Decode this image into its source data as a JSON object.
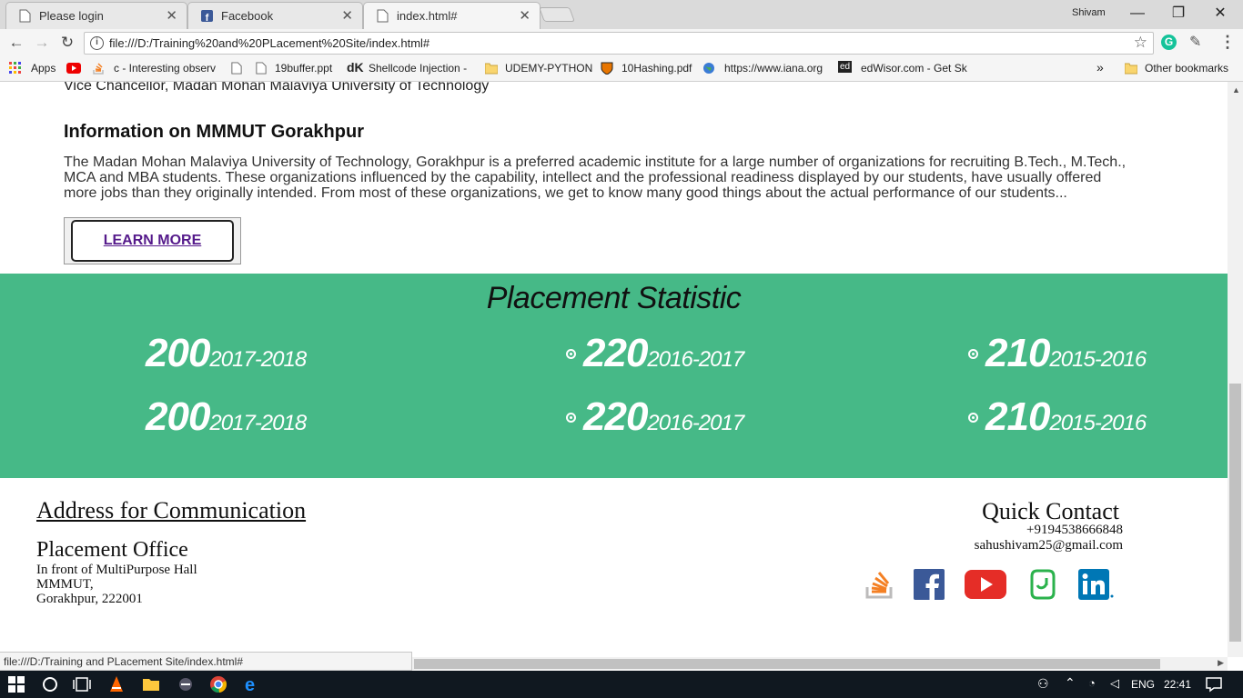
{
  "browser": {
    "tabs": [
      {
        "title": "Please login",
        "icon": "page-icon",
        "active": false
      },
      {
        "title": "Facebook",
        "icon": "facebook-favicon",
        "active": false
      },
      {
        "title": "index.html#",
        "icon": "page-icon",
        "active": true
      }
    ],
    "profile_name": "Shivam",
    "url": "file:///D:/Training%20and%20PLacement%20Site/index.html#",
    "bookmarks": [
      {
        "label": "Apps",
        "icon": "apps-icon"
      },
      {
        "label": "",
        "icon": "youtube-icon"
      },
      {
        "label": "c - Interesting observ",
        "icon": "stackoverflow-icon"
      },
      {
        "label": "",
        "icon": "page-icon"
      },
      {
        "label": "19buffer.ppt",
        "icon": "page-icon"
      },
      {
        "label": "Shellcode Injection -",
        "icon": "dk-icon"
      },
      {
        "label": "UDEMY-PYTHON",
        "icon": "folder-icon"
      },
      {
        "label": "10Hashing.pdf",
        "icon": "princeton-icon"
      },
      {
        "label": "https://www.iana.org",
        "icon": "globe-icon"
      },
      {
        "label": "edWisor.com - Get Sk",
        "icon": "edwisor-icon"
      }
    ],
    "more_bookmarks": "»",
    "other_bookmarks": "Other bookmarks",
    "status_url": "file:///D:/Training and PLacement Site/index.html#"
  },
  "page": {
    "vc_line": "Vice Chancellor, Madan Mohan Malaviya University of Technology",
    "info_heading": "Information on MMMUT Gorakhpur",
    "info_body": "The Madan Mohan Malaviya University of Technology, Gorakhpur is a preferred academic institute for a large number of organizations for recruiting B.Tech., M.Tech., MCA and MBA students. These organizations influenced by the capability, intellect and the professional readiness displayed by our students, have usually offered more jobs than they originally intended. From most of these organizations, we get to know many good things about the actual performance of our students...",
    "learn_more": "LEARN MORE",
    "stats_title": "Placement Statistic",
    "stats_rows": [
      [
        {
          "number": "200",
          "year": "2017-2018",
          "bullet": false
        },
        {
          "number": "220",
          "year": "2016-2017",
          "bullet": true
        },
        {
          "number": "210",
          "year": "2015-2016",
          "bullet": true
        }
      ],
      [
        {
          "number": "200",
          "year": "2017-2018",
          "bullet": false
        },
        {
          "number": "220",
          "year": "2016-2017",
          "bullet": true
        },
        {
          "number": "210",
          "year": "2015-2016",
          "bullet": true
        }
      ]
    ],
    "footer": {
      "address_title": "Address for Communication",
      "office_name": "Placement Office",
      "address_lines": [
        "In front of MultiPurpose Hall",
        "MMMUT,",
        "Gorakhpur, 222001"
      ],
      "quick_contact_title": "Quick Contact",
      "phone": "+919453866684​8",
      "email": "sahushivam25@gmail.com",
      "social": [
        "stackoverflow-icon",
        "facebook-icon",
        "youtube-icon",
        "saavn-icon",
        "linkedin-icon"
      ]
    }
  },
  "taskbar": {
    "lang": "ENG",
    "time": "22:41"
  },
  "colors": {
    "stats_bg": "#46b987",
    "link_visited": "#551a8b"
  }
}
